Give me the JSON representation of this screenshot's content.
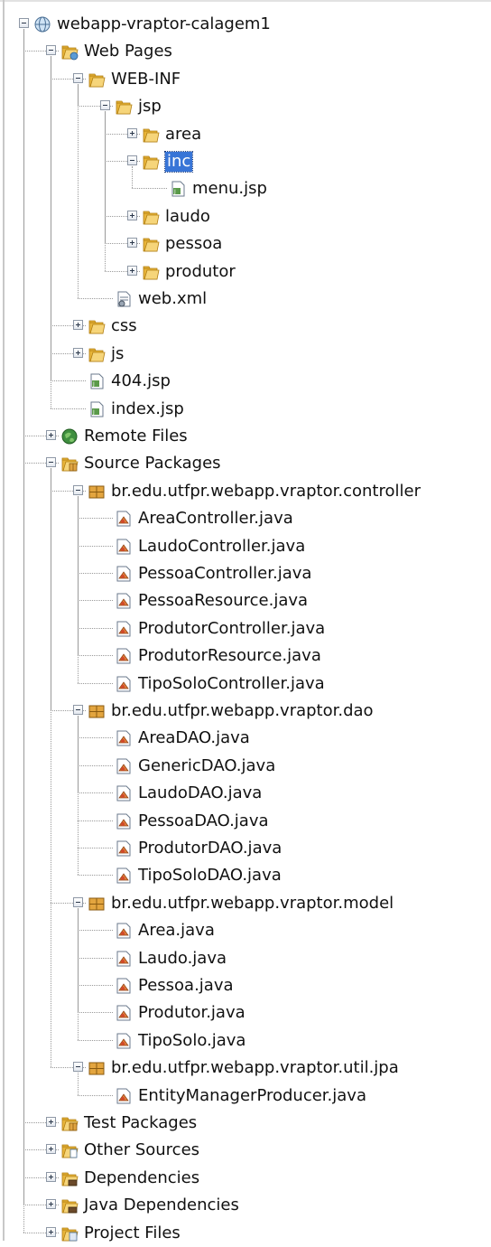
{
  "tree": [
    {
      "label": "webapp-vraptor-calagem1",
      "icon": "project-globe-icon",
      "depth": 0,
      "toggle": "minus"
    },
    {
      "label": "Web Pages",
      "icon": "web-pages-folder-icon",
      "depth": 1,
      "toggle": "minus"
    },
    {
      "label": "WEB-INF",
      "icon": "folder-icon",
      "depth": 2,
      "toggle": "minus"
    },
    {
      "label": "jsp",
      "icon": "folder-icon",
      "depth": 3,
      "toggle": "minus"
    },
    {
      "label": "area",
      "icon": "folder-icon",
      "depth": 4,
      "toggle": "plus"
    },
    {
      "label": "inc",
      "icon": "folder-icon",
      "depth": 4,
      "toggle": "minus",
      "selected": true
    },
    {
      "label": "menu.jsp",
      "icon": "jsp-file-icon",
      "depth": 5,
      "toggle": "none"
    },
    {
      "label": "laudo",
      "icon": "folder-icon",
      "depth": 4,
      "toggle": "plus"
    },
    {
      "label": "pessoa",
      "icon": "folder-icon",
      "depth": 4,
      "toggle": "plus"
    },
    {
      "label": "produtor",
      "icon": "folder-icon",
      "depth": 4,
      "toggle": "plus"
    },
    {
      "label": "web.xml",
      "icon": "xml-file-icon",
      "depth": 3,
      "toggle": "none"
    },
    {
      "label": "css",
      "icon": "folder-icon",
      "depth": 2,
      "toggle": "plus"
    },
    {
      "label": "js",
      "icon": "folder-icon",
      "depth": 2,
      "toggle": "plus"
    },
    {
      "label": "404.jsp",
      "icon": "jsp-file-icon",
      "depth": 2,
      "toggle": "none"
    },
    {
      "label": "index.jsp",
      "icon": "jsp-file-icon",
      "depth": 2,
      "toggle": "none"
    },
    {
      "label": "Remote Files",
      "icon": "remote-files-icon",
      "depth": 1,
      "toggle": "plus"
    },
    {
      "label": "Source Packages",
      "icon": "source-packages-icon",
      "depth": 1,
      "toggle": "minus"
    },
    {
      "label": "br.edu.utfpr.webapp.vraptor.controller",
      "icon": "package-icon",
      "depth": 2,
      "toggle": "minus"
    },
    {
      "label": "AreaController.java",
      "icon": "java-file-icon",
      "depth": 3,
      "toggle": "none"
    },
    {
      "label": "LaudoController.java",
      "icon": "java-file-icon",
      "depth": 3,
      "toggle": "none"
    },
    {
      "label": "PessoaController.java",
      "icon": "java-file-icon",
      "depth": 3,
      "toggle": "none"
    },
    {
      "label": "PessoaResource.java",
      "icon": "java-file-icon",
      "depth": 3,
      "toggle": "none"
    },
    {
      "label": "ProdutorController.java",
      "icon": "java-file-icon",
      "depth": 3,
      "toggle": "none"
    },
    {
      "label": "ProdutorResource.java",
      "icon": "java-file-icon",
      "depth": 3,
      "toggle": "none"
    },
    {
      "label": "TipoSoloController.java",
      "icon": "java-file-icon",
      "depth": 3,
      "toggle": "none"
    },
    {
      "label": "br.edu.utfpr.webapp.vraptor.dao",
      "icon": "package-icon",
      "depth": 2,
      "toggle": "minus"
    },
    {
      "label": "AreaDAO.java",
      "icon": "java-file-icon",
      "depth": 3,
      "toggle": "none"
    },
    {
      "label": "GenericDAO.java",
      "icon": "java-file-icon",
      "depth": 3,
      "toggle": "none"
    },
    {
      "label": "LaudoDAO.java",
      "icon": "java-file-icon",
      "depth": 3,
      "toggle": "none"
    },
    {
      "label": "PessoaDAO.java",
      "icon": "java-file-icon",
      "depth": 3,
      "toggle": "none"
    },
    {
      "label": "ProdutorDAO.java",
      "icon": "java-file-icon",
      "depth": 3,
      "toggle": "none"
    },
    {
      "label": "TipoSoloDAO.java",
      "icon": "java-file-icon",
      "depth": 3,
      "toggle": "none"
    },
    {
      "label": "br.edu.utfpr.webapp.vraptor.model",
      "icon": "package-icon",
      "depth": 2,
      "toggle": "minus"
    },
    {
      "label": "Area.java",
      "icon": "java-file-icon",
      "depth": 3,
      "toggle": "none"
    },
    {
      "label": "Laudo.java",
      "icon": "java-file-icon",
      "depth": 3,
      "toggle": "none"
    },
    {
      "label": "Pessoa.java",
      "icon": "java-file-icon",
      "depth": 3,
      "toggle": "none"
    },
    {
      "label": "Produtor.java",
      "icon": "java-file-icon",
      "depth": 3,
      "toggle": "none"
    },
    {
      "label": "TipoSolo.java",
      "icon": "java-file-icon",
      "depth": 3,
      "toggle": "none"
    },
    {
      "label": "br.edu.utfpr.webapp.vraptor.util.jpa",
      "icon": "package-icon",
      "depth": 2,
      "toggle": "minus"
    },
    {
      "label": "EntityManagerProducer.java",
      "icon": "java-file-icon",
      "depth": 3,
      "toggle": "none"
    },
    {
      "label": "Test Packages",
      "icon": "test-packages-icon",
      "depth": 1,
      "toggle": "plus"
    },
    {
      "label": "Other Sources",
      "icon": "other-sources-icon",
      "depth": 1,
      "toggle": "plus"
    },
    {
      "label": "Dependencies",
      "icon": "dependencies-icon",
      "depth": 1,
      "toggle": "plus"
    },
    {
      "label": "Java Dependencies",
      "icon": "java-dependencies-icon",
      "depth": 1,
      "toggle": "plus"
    },
    {
      "label": "Project Files",
      "icon": "project-files-icon",
      "depth": 1,
      "toggle": "plus"
    }
  ],
  "colors": {
    "selection": "#3875d7",
    "folder": "#e8b53a",
    "package": "#e3a53f",
    "globe": "#5a9bd5",
    "connector": "#9a9a9a"
  }
}
